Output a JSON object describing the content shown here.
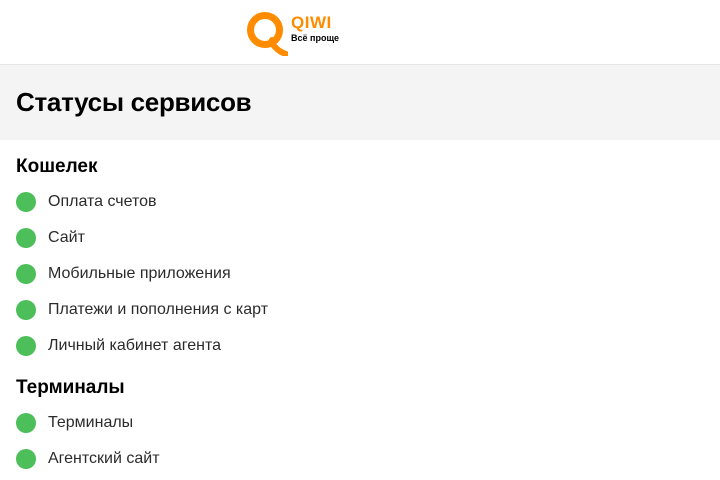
{
  "header": {
    "logo_word": "QIWI",
    "logo_slogan": "Всё проще",
    "brand_color": "#ff8c00"
  },
  "page_title": "Статусы сервисов",
  "status_color": "#4cbf5a",
  "sections": [
    {
      "title": "Кошелек",
      "services": [
        {
          "label": "Оплата счетов"
        },
        {
          "label": "Сайт"
        },
        {
          "label": "Мобильные приложения"
        },
        {
          "label": "Платежи и пополнения с карт"
        },
        {
          "label": "Личный кабинет агента"
        }
      ]
    },
    {
      "title": "Терминалы",
      "services": [
        {
          "label": "Терминалы"
        },
        {
          "label": "Агентский сайт"
        }
      ]
    }
  ]
}
